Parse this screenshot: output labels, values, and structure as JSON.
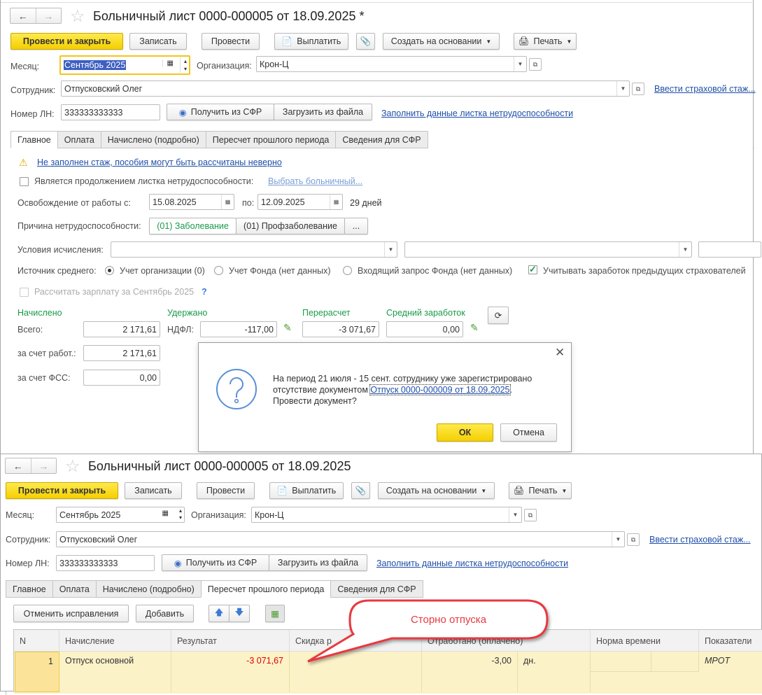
{
  "top_form": {
    "title": "Больничный лист 0000-000005 от 18.09.2025 *",
    "toolbar": {
      "post_close": "Провести и закрыть",
      "save": "Записать",
      "post": "Провести",
      "pay": "Выплатить",
      "create_based": "Создать на основании",
      "print": "Печать"
    },
    "month_label": "Месяц:",
    "month_value": "Сентябрь 2025",
    "org_label": "Организация:",
    "org_value": "Крон-Ц",
    "employee_label": "Сотрудник:",
    "employee_value": "Отпусковский Олег",
    "insurance_link": "Ввести страховой стаж...",
    "ln_label": "Номер ЛН:",
    "ln_value": "333333333333",
    "get_sfr": "Получить из СФР",
    "load_file": "Загрузить из файла",
    "fill_link": "Заполнить данные листка нетрудоспособности",
    "tabs": [
      "Главное",
      "Оплата",
      "Начислено (подробно)",
      "Пересчет прошлого периода",
      "Сведения для СФР"
    ],
    "active_tab": "Главное",
    "warning": "Не заполнен стаж, пособия могут быть рассчитаны неверно",
    "continuation_label": "Является продолжением листка нетрудоспособности:",
    "continuation_checked": false,
    "choose_link": "Выбрать больничный...",
    "release_label": "Освобождение от работы с:",
    "date_from": "15.08.2025",
    "to_label": "по:",
    "date_to": "12.09.2025",
    "days": "29 дней",
    "reason_label": "Причина нетрудоспособности:",
    "reason_options": [
      "(01) Заболевание",
      "(01) Профзаболевание",
      "..."
    ],
    "conditions_label": "Условия исчисления:",
    "source_label": "Источник среднего:",
    "source_options": [
      "Учет организации (0)",
      "Учет Фонда (нет данных)",
      "Входящий запрос Фонда (нет данных)"
    ],
    "source_selected": "Учет организации (0)",
    "prev_insurers_label": "Учитывать заработок предыдущих страхователей",
    "prev_insurers_checked": true,
    "calc_salary_label": "Рассчитать зарплату за Сентябрь 2025",
    "help": "?",
    "accrued_title": "Начислено",
    "withheld_title": "Удержано",
    "recalc_title": "Перерасчет",
    "avg_title": "Средний заработок",
    "total_label": "Всего:",
    "total_value": "2 171,61",
    "ndfl_label": "НДФЛ:",
    "ndfl_value": "-117,00",
    "recalc_value": "-3 071,67",
    "avg_value": "0,00",
    "employer_label": "за счет работ.:",
    "employer_value": "2 171,61",
    "fss_label": "за счет ФСС:",
    "fss_value": "0,00"
  },
  "dialog": {
    "line1": "На период 21 июля - 15 сент. сотруднику уже зарегистрировано",
    "line2": "отсутствие документом ",
    "link": "Отпуск 0000-000009 от 18.09.2025",
    "line2_end": ".",
    "line3": "Провести документ?",
    "ok": "ОК",
    "cancel": "Отмена"
  },
  "bottom_form": {
    "title": "Больничный лист 0000-000005 от 18.09.2025",
    "toolbar": {
      "post_close": "Провести и закрыть",
      "save": "Записать",
      "post": "Провести",
      "pay": "Выплатить",
      "create_based": "Создать на основании",
      "print": "Печать"
    },
    "month_label": "Месяц:",
    "month_value": "Сентябрь 2025",
    "org_label": "Организация:",
    "org_value": "Крон-Ц",
    "employee_label": "Сотрудник:",
    "employee_value": "Отпусковский Олег",
    "insurance_link": "Ввести страховой стаж...",
    "ln_label": "Номер ЛН:",
    "ln_value": "333333333333",
    "get_sfr": "Получить из СФР",
    "load_file": "Загрузить из файла",
    "fill_link": "Заполнить данные листка нетрудоспособности",
    "tabs": [
      "Главное",
      "Оплата",
      "Начислено (подробно)",
      "Пересчет прошлого периода",
      "Сведения для СФР"
    ],
    "active_tab": "Пересчет прошлого периода",
    "cancel_corrections": "Отменить исправления",
    "add": "Добавить",
    "columns": [
      "N",
      "Начисление",
      "Результат",
      "Скидка р",
      "Отработано (оплачено)",
      "Норма времени",
      "Показатели"
    ],
    "rows": [
      {
        "n": "1",
        "accrual": "Отпуск основной",
        "result": "-3 071,67",
        "worked": "-3,00",
        "unit": "дн.",
        "indicators": "МРОТ"
      }
    ]
  },
  "callout": {
    "text": "Сторно отпуска"
  },
  "colors": {
    "accent_yellow": "#f4cf00",
    "link": "#1f4fa8",
    "green": "#1a9a4a",
    "negative": "#e00000",
    "callout": "#e8393f",
    "row_highlight": "#fcf2c8"
  }
}
